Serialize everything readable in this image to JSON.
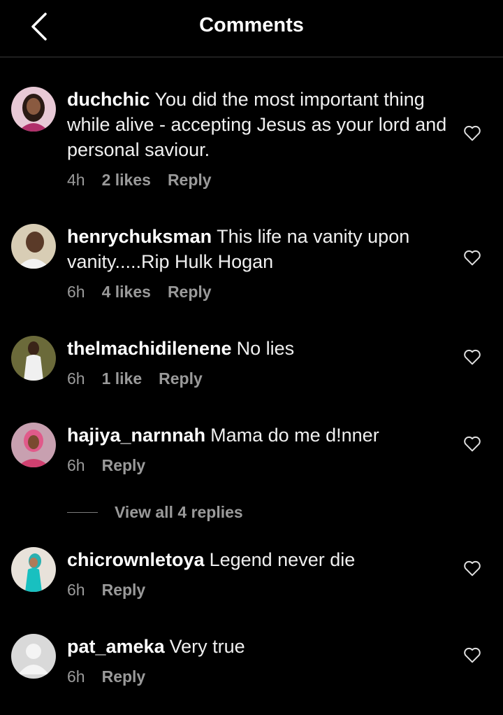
{
  "header": {
    "title": "Comments",
    "back_icon": "chevron-left-icon"
  },
  "comments": [
    {
      "username": "duchchic",
      "text": "You did the most important thing while alive - accepting Jesus as your lord and personal saviour.",
      "time": "4h",
      "likes": "2 likes",
      "reply": "Reply",
      "avatar_color": "#8a2a6a"
    },
    {
      "username": "henrychuksman",
      "text": "This life na vanity upon vanity.....Rip Hulk Hogan",
      "time": "6h",
      "likes": "4 likes",
      "reply": "Reply",
      "avatar_color": "#c9bfa8"
    },
    {
      "username": "thelmachidilenene",
      "text": "No lies",
      "time": "6h",
      "likes": "1 like",
      "reply": "Reply",
      "avatar_color": "#6b6a3a"
    },
    {
      "username": "hajiya_narnnah",
      "text": "Mama do me d!nner",
      "time": "6h",
      "likes": "",
      "reply": "Reply",
      "avatar_color": "#c24a7a"
    },
    {
      "username": "chicrownletoya",
      "text": "Legend never die",
      "time": "6h",
      "likes": "",
      "reply": "Reply",
      "avatar_color": "#2ab0b0"
    },
    {
      "username": "pat_ameka",
      "text": "Very true",
      "time": "6h",
      "likes": "",
      "reply": "Reply",
      "avatar_color": "#d9d9d9"
    }
  ],
  "view_replies": {
    "label": "View all 4 replies"
  },
  "colors": {
    "background": "#000000",
    "text": "#f5f5f5",
    "meta": "#9a9a9a",
    "divider": "#3a3a3a"
  }
}
